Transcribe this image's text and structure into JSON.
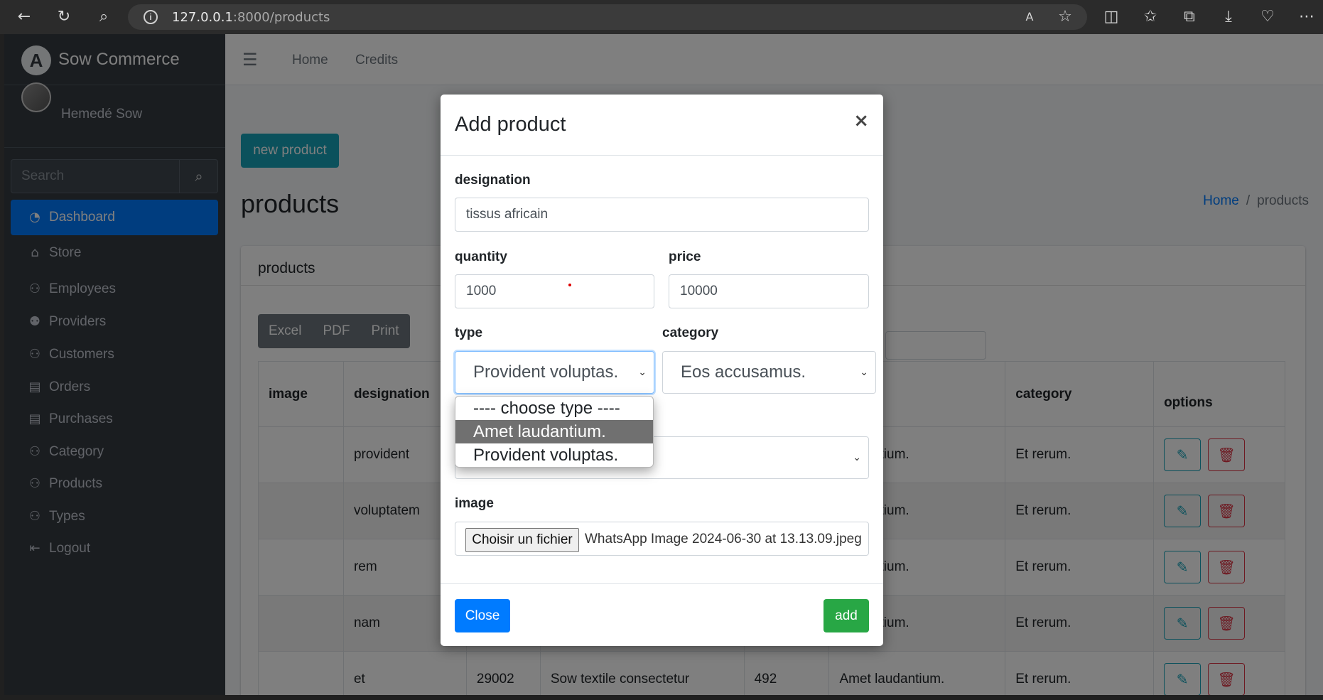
{
  "browser": {
    "url_host": "127.0.0.1",
    "url_rest": ":8000/products",
    "back_icon": "arrow-left-icon",
    "reload_icon": "reload-icon",
    "search_icon": "search-icon"
  },
  "sidebar": {
    "brand": "Sow Commerce",
    "user": "Hemedé Sow",
    "search_placeholder": "Search",
    "items": [
      {
        "label": "Dashboard",
        "icon": "tachometer-icon",
        "active": true
      },
      {
        "label": "Store",
        "icon": "store-icon"
      },
      {
        "label": "Employees",
        "icon": "users-icon"
      },
      {
        "label": "Providers",
        "icon": "user-friends-icon"
      },
      {
        "label": "Customers",
        "icon": "users-icon"
      },
      {
        "label": "Orders",
        "icon": "list-icon"
      },
      {
        "label": "Purchases",
        "icon": "list-icon"
      },
      {
        "label": "Category",
        "icon": "users-icon"
      },
      {
        "label": "Products",
        "icon": "users-icon"
      },
      {
        "label": "Types",
        "icon": "users-icon"
      },
      {
        "label": "Logout",
        "icon": "sign-out-icon"
      }
    ]
  },
  "topnav": {
    "links": [
      "Home",
      "Credits"
    ]
  },
  "content": {
    "new_button": "new product",
    "title": "products",
    "breadcrumb_home": "Home",
    "breadcrumb_current": "products",
    "card_title": "products",
    "export_buttons": [
      "Excel",
      "PDF",
      "Print"
    ],
    "table": {
      "headers": [
        "image",
        "designation",
        "",
        "",
        "",
        "",
        "category",
        "options"
      ],
      "rows": [
        [
          "",
          "provident",
          "",
          "",
          "",
          "laudantium.",
          "Et rerum."
        ],
        [
          "",
          "voluptatem",
          "",
          "",
          "",
          "laudantium.",
          "Et rerum."
        ],
        [
          "",
          "rem",
          "",
          "",
          "",
          "laudantium.",
          "Et rerum."
        ],
        [
          "",
          "nam",
          "",
          "",
          "",
          "laudantium.",
          "Et rerum."
        ],
        [
          "",
          "et",
          "29002",
          "Sow textile consectetur",
          "492",
          "Amet laudantium.",
          "Et rerum."
        ]
      ]
    }
  },
  "modal": {
    "title": "Add product",
    "close_x": "×",
    "designation_label": "designation",
    "designation_value": "tissus africain",
    "quantity_label": "quantity",
    "quantity_value": "1000",
    "price_label": "price",
    "price_value": "10000",
    "type_label": "type",
    "type_value": "Provident voluptas.",
    "category_label": "category",
    "category_value": "Eos accusamus.",
    "type_options": [
      "---- choose type ----",
      "Amet laudantium.",
      "Provident voluptas."
    ],
    "image_label": "image",
    "file_button": "Choisir un fichier",
    "file_name": "WhatsApp Image 2024-06-30 at 13.13.09.jpeg",
    "close_button": "Close",
    "add_button": "add"
  }
}
